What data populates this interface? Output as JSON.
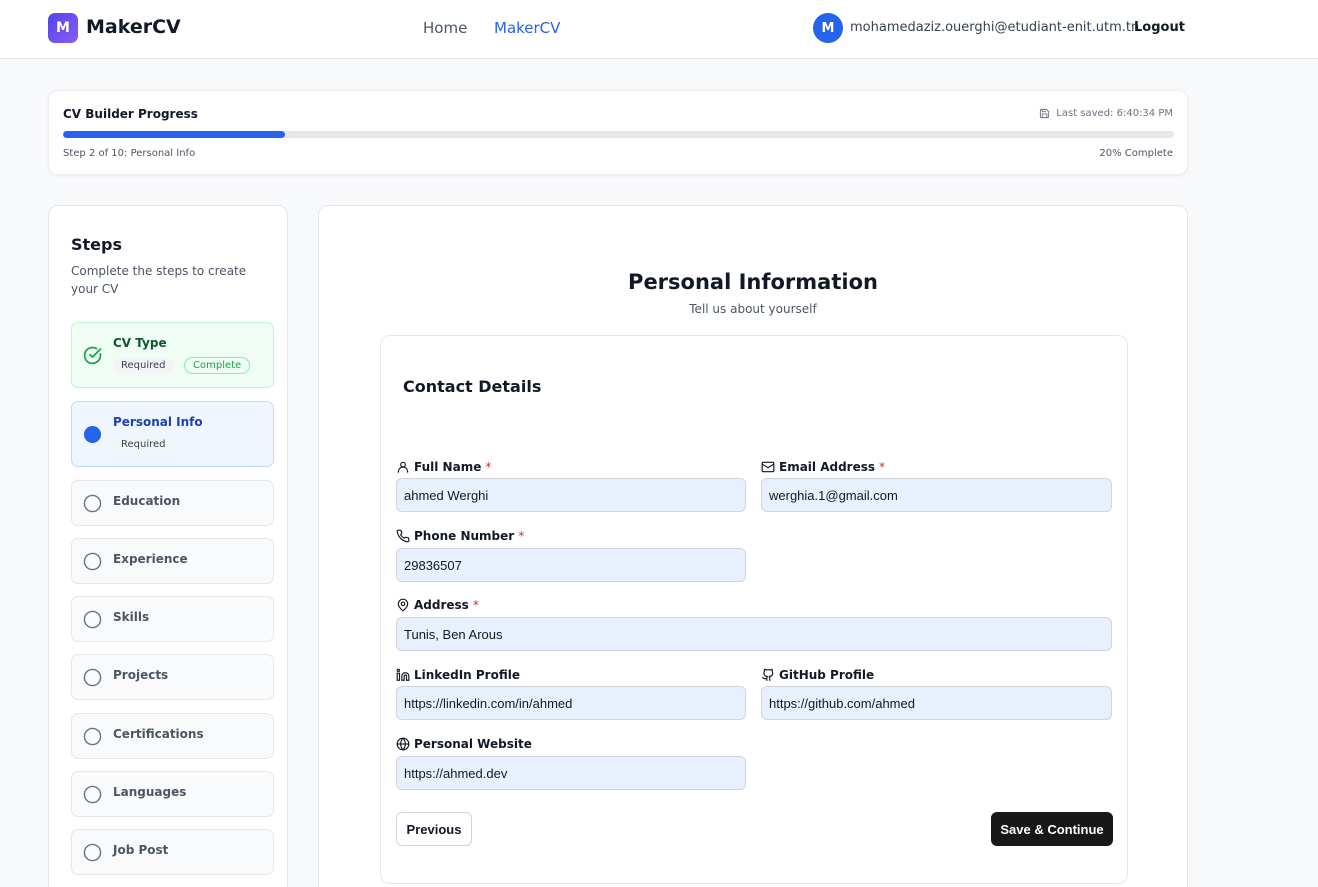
{
  "header": {
    "logo_letter": "M",
    "brand": "MakerCV",
    "nav": [
      {
        "label": "Home"
      },
      {
        "label": "MakerCV"
      }
    ],
    "user_initial": "M",
    "user_email": "mohamedaziz.ouerghi@etudiant-enit.utm.tn",
    "logout_label": "Logout"
  },
  "progress": {
    "title": "CV Builder Progress",
    "last_saved": "Last saved: 6:40:34 PM",
    "step_text": "Step 2 of 10: Personal Info",
    "percent_text": "20% Complete",
    "fraction": 0.2
  },
  "steps": {
    "title": "Steps",
    "subtitle": "Complete the steps to create your CV",
    "items": [
      {
        "label": "CV Type",
        "status": "complete",
        "badges": [
          "Required",
          "Complete"
        ]
      },
      {
        "label": "Personal Info",
        "status": "active",
        "badges": [
          "Required"
        ]
      },
      {
        "label": "Education",
        "status": "pending"
      },
      {
        "label": "Experience",
        "status": "pending"
      },
      {
        "label": "Skills",
        "status": "pending"
      },
      {
        "label": "Projects",
        "status": "pending"
      },
      {
        "label": "Certifications",
        "status": "pending"
      },
      {
        "label": "Languages",
        "status": "pending"
      },
      {
        "label": "Job Post",
        "status": "pending"
      }
    ]
  },
  "main": {
    "title": "Personal Information",
    "subtitle": "Tell us about yourself",
    "section_title": "Contact Details",
    "required_mark": "*",
    "fields": {
      "full_name": {
        "label": "Full Name",
        "value": "ahmed Werghi",
        "required": true,
        "icon": "user-icon"
      },
      "email": {
        "label": "Email Address",
        "value": "werghia.1@gmail.com",
        "required": true,
        "icon": "mail-icon"
      },
      "phone": {
        "label": "Phone Number",
        "value": "29836507",
        "required": true,
        "icon": "phone-icon"
      },
      "address": {
        "label": "Address",
        "value": "Tunis, Ben Arous",
        "required": true,
        "icon": "map-pin-icon"
      },
      "linkedin": {
        "label": "LinkedIn Profile",
        "value": "https://linkedin.com/in/ahmed",
        "required": false,
        "icon": "linkedin-icon"
      },
      "github": {
        "label": "GitHub Profile",
        "value": "https://github.com/ahmed",
        "required": false,
        "icon": "github-icon"
      },
      "website": {
        "label": "Personal Website",
        "value": "https://ahmed.dev",
        "required": false,
        "icon": "globe-icon"
      }
    },
    "previous_label": "Previous",
    "save_label": "Save & Continue"
  },
  "colors": {
    "accent": "#2563eb",
    "success": "#16a34a",
    "required": "#dc2626",
    "input_bg": "#e8f0fe"
  }
}
